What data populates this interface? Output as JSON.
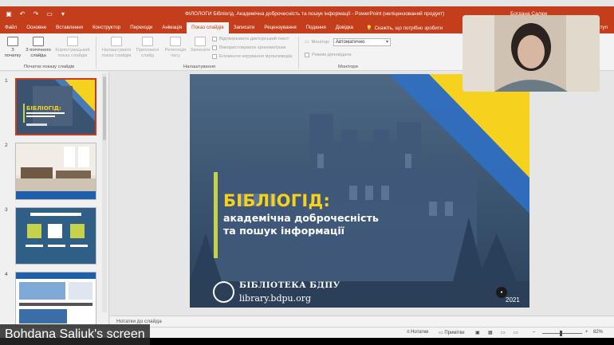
{
  "window": {
    "title": "ФІЛОЛОГИ Бібліогід. Академічна доброчесність та пошук інформації  -  PowerPoint (неліцензований продукт)",
    "user": "Богдана Салюк"
  },
  "ribbon_tabs": [
    "Файл",
    "Основне",
    "Вставлення",
    "Конструктор",
    "Переходи",
    "Анімація",
    "Показ слайдів",
    "Записати",
    "Рецензування",
    "Подання",
    "Довідка"
  ],
  "active_tab": "Показ слайдів",
  "tell_me": "Скажіть, що потрібно зробити",
  "share_label": "Спільний доступ",
  "ribbon": {
    "from_beginning": "З початку",
    "from_current": "З поточного слайда",
    "custom_show": "Користувацький показ слайдів",
    "set_up": "Налаштувати показ слайдів",
    "hide_slide": "Приховати слайд",
    "rehearse": "Репетиція часу",
    "record": "Записати",
    "play_narrations": "Відтворювати дикторський текст",
    "use_timings": "Використовувати хронометраж",
    "show_media_controls": "Елементи керування мультимедіа",
    "monitor_label": "Монітор:",
    "monitor_value": "Автоматично",
    "presenter_view": "Режим доповідача",
    "group_start": "Початок показу слайдів",
    "group_setup": "Налаштування",
    "group_monitors": "Монітори"
  },
  "thumbnails": [
    {
      "num": "1",
      "title": "БІБЛІОГІД:",
      "sub": "академічна доброчесність та пошук інформації"
    },
    {
      "num": "2",
      "caption": "КАБІНЕТ 2 п.ч.  ЧИТАЛЬНА ЗАЛА ВІДДІЛУ"
    },
    {
      "num": "3",
      "title": "АКАДЕМІЧНА ДОБРОЧЕСНІСТЬ"
    },
    {
      "num": "4"
    }
  ],
  "slide": {
    "title": "БІБЛІОГІД:",
    "subtitle_line1": "академічна доброчесність",
    "subtitle_line2": "та пошук інформації",
    "library_name": "БІБЛІОТЕКА БДПУ",
    "library_url": "library.bdpu.org",
    "year": "2021"
  },
  "notes_placeholder": "Нотатки до слайда",
  "statusbar": {
    "notes": "Нотатки",
    "comments": "Примітки",
    "zoom": "82%"
  },
  "screen_share_label": "Bohdana Saliuk's screen",
  "colors": {
    "accent": "#c43e1c",
    "slide_yellow": "#f6d21e",
    "slide_blue": "#2f4660"
  }
}
